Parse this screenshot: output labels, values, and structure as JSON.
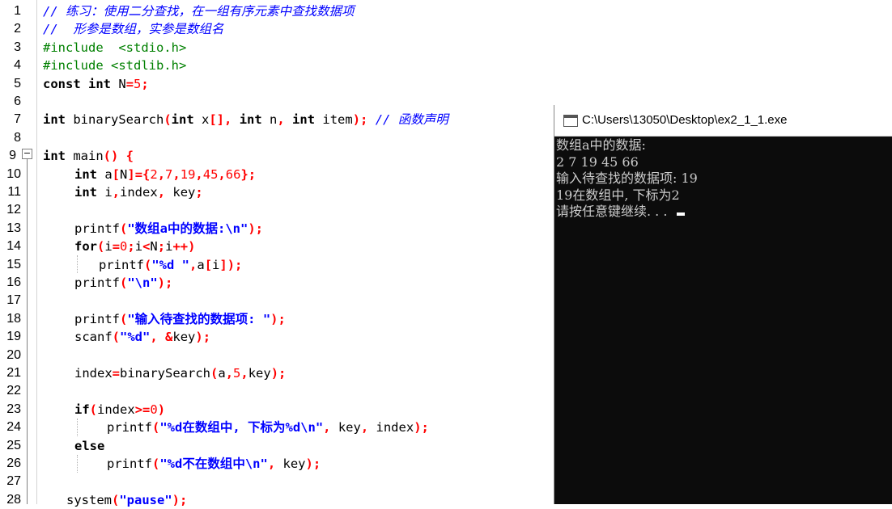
{
  "editor": {
    "line_numbers": [
      "1",
      "2",
      "3",
      "4",
      "5",
      "6",
      "7",
      "8",
      "9",
      "10",
      "11",
      "12",
      "13",
      "14",
      "15",
      "16",
      "17",
      "18",
      "19",
      "20",
      "21",
      "22",
      "23",
      "24",
      "25",
      "26",
      "27",
      "28"
    ],
    "fold_symbol": "−",
    "lines": {
      "l1": "// 练习：使用二分查找，在一组有序元素中查找数据项",
      "l2": "//  形参是数组，实参是数组名",
      "l3": "#include  <stdio.h>",
      "l4": "#include <stdlib.h>",
      "l5a": "const",
      "l5b": " ",
      "l5c": "int",
      "l5d": " N",
      "l5e": "=",
      "l5f": "5",
      "l5g": ";",
      "l7a": "int",
      "l7b": " binarySearch",
      "l7c": "(",
      "l7d": "int",
      "l7e": " x",
      "l7f": "[],",
      "l7g": " ",
      "l7h": "int",
      "l7i": " n",
      "l7j": ",",
      "l7k": " ",
      "l7l": "int",
      "l7m": " item",
      "l7n": ");",
      "l7o": " // 函数声明",
      "l9a": "int",
      "l9b": " main",
      "l9c": "()",
      "l9d": " {",
      "l10a": "int",
      "l10b": " a",
      "l10c": "[",
      "l10d": "N",
      "l10e": "]={",
      "l10f": "2",
      "l10g": ",",
      "l10h": "7",
      "l10i": ",",
      "l10j": "19",
      "l10k": ",",
      "l10l": "45",
      "l10m": ",",
      "l10n": "66",
      "l10o": "};",
      "l11a": "int",
      "l11b": " i",
      "l11c": ",",
      "l11d": "index",
      "l11e": ",",
      "l11f": " key",
      "l11g": ";",
      "l13a": "printf",
      "l13b": "(",
      "l13c": "\"数组a中的数据:\\n\"",
      "l13d": ");",
      "l14a": "for",
      "l14b": "(",
      "l14c": "i",
      "l14d": "=",
      "l14e": "0",
      "l14f": ";",
      "l14g": "i",
      "l14h": "<",
      "l14i": "N",
      "l14j": ";",
      "l14k": "i",
      "l14l": "++)",
      "l15a": "printf",
      "l15b": "(",
      "l15c": "\"%d \"",
      "l15d": ",",
      "l15e": "a",
      "l15f": "[",
      "l15g": "i",
      "l15h": "]);",
      "l16a": "printf",
      "l16b": "(",
      "l16c": "\"\\n\"",
      "l16d": ");",
      "l18a": "printf",
      "l18b": "(",
      "l18c": "\"输入待查找的数据项: \"",
      "l18d": ");",
      "l19a": "scanf",
      "l19b": "(",
      "l19c": "\"%d\"",
      "l19d": ",",
      "l19e": " &",
      "l19f": "key",
      "l19g": ");",
      "l21a": "index",
      "l21b": "=",
      "l21c": "binarySearch",
      "l21d": "(",
      "l21e": "a",
      "l21f": ",",
      "l21g": "5",
      "l21h": ",",
      "l21i": "key",
      "l21j": ");",
      "l23a": "if",
      "l23b": "(",
      "l23c": "index",
      "l23d": ">=",
      "l23e": "0",
      "l23f": ")",
      "l24a": "printf",
      "l24b": "(",
      "l24c": "\"%d在数组中, 下标为%d\\n\"",
      "l24d": ",",
      "l24e": " key",
      "l24f": ",",
      "l24g": " index",
      "l24h": ");",
      "l25a": "else",
      "l26a": "printf",
      "l26b": "(",
      "l26c": "\"%d不在数组中\\n\"",
      "l26d": ",",
      "l26e": " key",
      "l26f": ");",
      "l28a": "system",
      "l28b": "(",
      "l28c": "\"pause\"",
      "l28d": ");"
    }
  },
  "console": {
    "title": "C:\\Users\\13050\\Desktop\\ex2_1_1.exe",
    "lines": [
      "数组a中的数据:",
      "2 7 19 45 66",
      "输入待查找的数据项: 19",
      "19在数组中, 下标为2",
      "请按任意键继续. . . "
    ]
  }
}
